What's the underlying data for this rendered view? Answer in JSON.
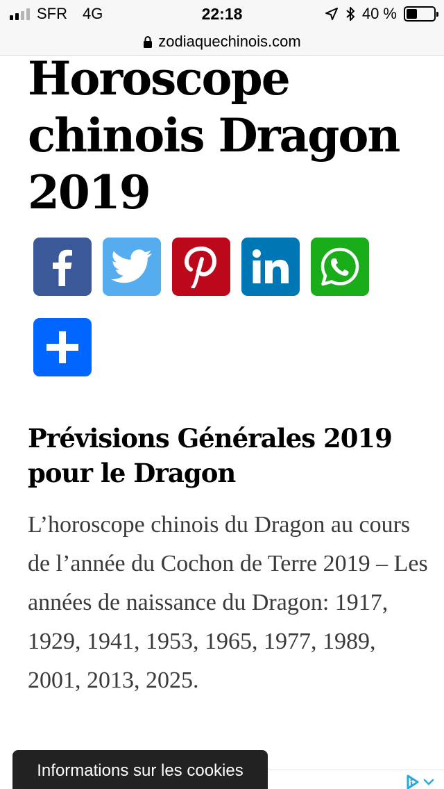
{
  "status_bar": {
    "carrier": "SFR",
    "network": "4G",
    "time": "22:18",
    "battery": "40 %",
    "battery_level": 0.4
  },
  "url_bar": {
    "url": "zodiaquechinois.com"
  },
  "article": {
    "title": "Horoscope chinois Dragon 2019",
    "section_heading": "Prévisions Générales 2019 pour le Dragon",
    "paragraph": "L’horoscope chinois du Dragon au cours de l’année du Cochon de Terre 2019 – Les années de naissance du Dragon: 1917, 1929, 1941, 1953, 1965, 1977, 1989, 2001, 2013, 2025."
  },
  "share_buttons": [
    {
      "name": "facebook",
      "icon": "facebook-icon",
      "color": "#3b5998"
    },
    {
      "name": "twitter",
      "icon": "twitter-icon",
      "color": "#55acee"
    },
    {
      "name": "pinterest",
      "icon": "pinterest-icon",
      "color": "#bd081c"
    },
    {
      "name": "linkedin",
      "icon": "linkedin-icon",
      "color": "#0077b5"
    },
    {
      "name": "whatsapp",
      "icon": "whatsapp-icon",
      "color": "#1aad1a"
    },
    {
      "name": "more",
      "icon": "plus-icon",
      "color": "#0066ff"
    }
  ],
  "cookie_banner": {
    "label": "Informations sur les cookies"
  }
}
